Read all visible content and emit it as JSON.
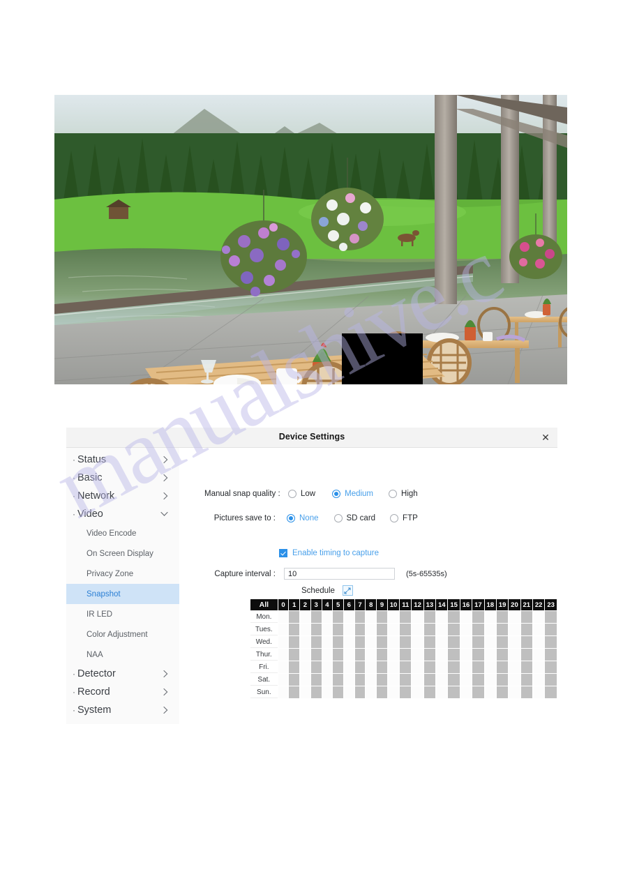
{
  "watermark": {
    "text": "manualshive.c"
  },
  "preview": {
    "name": "camera-live-preview",
    "description": "Outdoor terrace overlooking a lake with hanging flower baskets, wooden dining tables and chairs",
    "redaction": "black-redaction-box"
  },
  "dialog": {
    "title": "Device Settings",
    "close_label": "✕"
  },
  "sidebar": {
    "groups": [
      {
        "label": "Status",
        "chevron": "chevron-right",
        "expanded": false
      },
      {
        "label": "Basic",
        "chevron": "chevron-right",
        "expanded": false
      },
      {
        "label": "Network",
        "chevron": "chevron-right",
        "expanded": false
      },
      {
        "label": "Video",
        "chevron": "chevron-down",
        "expanded": true
      }
    ],
    "video_items": [
      {
        "label": "Video Encode",
        "active": false
      },
      {
        "label": "On Screen Display",
        "active": false
      },
      {
        "label": "Privacy Zone",
        "active": false
      },
      {
        "label": "Snapshot",
        "active": true
      },
      {
        "label": "IR LED",
        "active": false
      },
      {
        "label": "Color Adjustment",
        "active": false
      },
      {
        "label": "NAA",
        "active": false
      }
    ],
    "groups_bottom": [
      {
        "label": "Detector",
        "chevron": "chevron-right"
      },
      {
        "label": "Record",
        "chevron": "chevron-right"
      },
      {
        "label": "System",
        "chevron": "chevron-right"
      }
    ]
  },
  "form": {
    "snap_quality": {
      "label": "Manual snap quality :",
      "options": [
        {
          "label": "Low",
          "selected": false
        },
        {
          "label": "Medium",
          "selected": true
        },
        {
          "label": "High",
          "selected": false
        }
      ]
    },
    "pictures_save_to": {
      "label": "Pictures save to :",
      "options": [
        {
          "label": "None",
          "selected": true
        },
        {
          "label": "SD card",
          "selected": false
        },
        {
          "label": "FTP",
          "selected": false
        }
      ]
    },
    "enable_timing": {
      "label": "Enable timing to capture",
      "checked": true
    },
    "capture_interval": {
      "label": "Capture interval :",
      "value": "10",
      "hint": "(5s-65535s)"
    },
    "schedule_header": {
      "label": "Schedule",
      "expand_icon": "expand-diagonal-icon"
    }
  },
  "colors": {
    "accent": "#2b90e8",
    "accent_text": "#49a0ea",
    "active_row": "#cfe3f7",
    "header_cell": "#0d0d0d",
    "slot_on": "#bfbfbf",
    "slot_off": "#fcfcfc"
  },
  "schedule": {
    "all_label": "All",
    "hours": [
      "0",
      "1",
      "2",
      "3",
      "4",
      "5",
      "6",
      "7",
      "8",
      "9",
      "10",
      "11",
      "12",
      "13",
      "14",
      "15",
      "16",
      "17",
      "18",
      "19",
      "20",
      "21",
      "22",
      "23"
    ],
    "days": [
      "Mon.",
      "Tues.",
      "Wed.",
      "Thur.",
      "Fri.",
      "Sat.",
      "Sun."
    ],
    "selection": [
      [
        0,
        1,
        0,
        1,
        0,
        1,
        0,
        1,
        0,
        1,
        0,
        1,
        0,
        1,
        0,
        1,
        0,
        1,
        0,
        1,
        0,
        1,
        0,
        1
      ],
      [
        0,
        1,
        0,
        1,
        0,
        1,
        0,
        1,
        0,
        1,
        0,
        1,
        0,
        1,
        0,
        1,
        0,
        1,
        0,
        1,
        0,
        1,
        0,
        1
      ],
      [
        0,
        1,
        0,
        1,
        0,
        1,
        0,
        1,
        0,
        1,
        0,
        1,
        0,
        1,
        0,
        1,
        0,
        1,
        0,
        1,
        0,
        1,
        0,
        1
      ],
      [
        0,
        1,
        0,
        1,
        0,
        1,
        0,
        1,
        0,
        1,
        0,
        1,
        0,
        1,
        0,
        1,
        0,
        1,
        0,
        1,
        0,
        1,
        0,
        1
      ],
      [
        0,
        1,
        0,
        1,
        0,
        1,
        0,
        1,
        0,
        1,
        0,
        1,
        0,
        1,
        0,
        1,
        0,
        1,
        0,
        1,
        0,
        1,
        0,
        1
      ],
      [
        0,
        1,
        0,
        1,
        0,
        1,
        0,
        1,
        0,
        1,
        0,
        1,
        0,
        1,
        0,
        1,
        0,
        1,
        0,
        1,
        0,
        1,
        0,
        1
      ],
      [
        0,
        1,
        0,
        1,
        0,
        1,
        0,
        1,
        0,
        1,
        0,
        1,
        0,
        1,
        0,
        1,
        0,
        1,
        0,
        1,
        0,
        1,
        0,
        1
      ]
    ]
  }
}
